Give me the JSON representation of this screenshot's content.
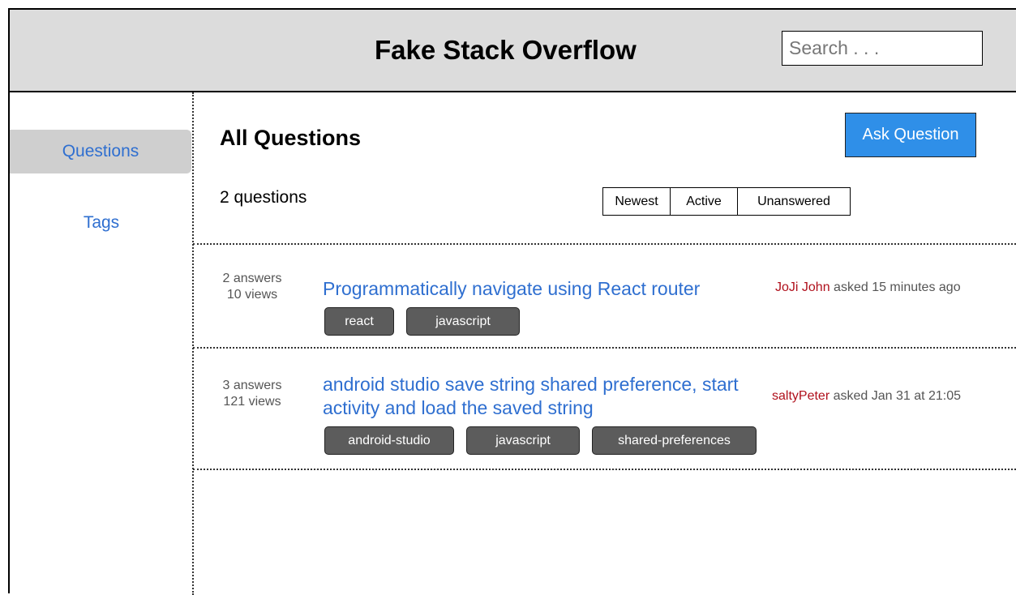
{
  "header": {
    "title": "Fake Stack Overflow",
    "search_placeholder": "Search . . ."
  },
  "sidebar": {
    "items": [
      {
        "label": "Questions",
        "active": true
      },
      {
        "label": "Tags",
        "active": false
      }
    ]
  },
  "main": {
    "title": "All Questions",
    "ask_button": "Ask Question",
    "question_count": "2 questions",
    "sort_options": [
      "Newest",
      "Active",
      "Unanswered"
    ],
    "questions": [
      {
        "answers": "2 answers",
        "views": "10 views",
        "title": "Programmatically navigate using React router",
        "author": "JoJi John",
        "asked": "asked 15 minutes ago",
        "tags": [
          "react",
          "javascript"
        ]
      },
      {
        "answers": "3 answers",
        "views": "121 views",
        "title": "android studio save string shared preference, start activity and load the saved string",
        "author": "saltyPeter",
        "asked": "asked Jan 31 at 21:05",
        "tags": [
          "android-studio",
          "javascript",
          "shared-preferences"
        ]
      }
    ]
  },
  "colors": {
    "header_bg": "#dcdcdc",
    "link_blue": "#2f6fd0",
    "ask_button_bg": "#2f8fe8",
    "author_red": "#b0101c",
    "tag_bg": "#5c5c5c"
  }
}
